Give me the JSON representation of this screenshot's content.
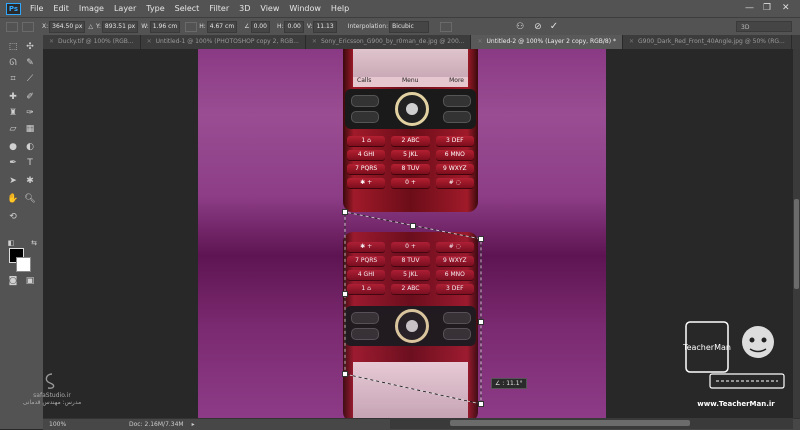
{
  "app": {
    "logo_text": "Ps"
  },
  "menu": [
    "File",
    "Edit",
    "Image",
    "Layer",
    "Type",
    "Select",
    "Filter",
    "3D",
    "View",
    "Window",
    "Help"
  ],
  "window_controls": [
    "—",
    "❐",
    "✕"
  ],
  "options_bar": {
    "x_label": "X:",
    "x_value": "364.50 px",
    "y_label": "Y:",
    "y_value": "893.51 px",
    "w_label": "W:",
    "w_value": "1.96 cm",
    "h_label": "H:",
    "h_value": "4.67 cm",
    "angle_value": "0.00",
    "hskew_label": "H:",
    "hskew_value": "0.00",
    "vskew_label": "V:",
    "vskew_value": "11.13",
    "interp_label": "Interpolation:",
    "interp_value": "Bicubic",
    "workspace": "3D"
  },
  "tabs": [
    {
      "label": "Ducky.tif @ 100% (RGB..."
    },
    {
      "label": "Untitled-1 @ 100% (PHOTOSHOP copy 2, RGB..."
    },
    {
      "label": "Sony_Ericsson_G900_by_r0man_de.jpg @ 200..."
    },
    {
      "label": "Untitled-2 @ 100% (Layer 2 copy, RGB/8) *"
    },
    {
      "label": "G900_Dark_Red_Front_40Angle.jpg @ 50% (RG..."
    }
  ],
  "phone": {
    "soft_keys": [
      "Calls",
      "Menu",
      "More"
    ],
    "keys": [
      "1 ⌂",
      "2 ABC",
      "3 DEF",
      "4 GHI",
      "5 JKL",
      "6 MNO",
      "7 PQRS",
      "8 TUV",
      "9 WXYZ",
      "✱ +",
      "0 +",
      "# ◌"
    ],
    "keys_reflect": [
      "✱ +",
      "0 +",
      "# ◌",
      "7 PQRS",
      "8 TUV",
      "9 WXYZ",
      "4 GHI",
      "5 JKL",
      "6 MNO",
      "1 ⌂",
      "2 ABC",
      "3 DEF"
    ]
  },
  "transform_readout": "∠ : 11.1°",
  "status": {
    "zoom": "100%",
    "doc": "Doc: 2.16M/7.34M"
  },
  "watermark_left": {
    "line1": "safaStudio.ir",
    "line2": "مدرس: مهندس قدمانی"
  },
  "watermark_right": {
    "brand": "TeacherMan",
    "site": "www.TeacherMan.ir"
  },
  "colors": {
    "accent": "#31a8ff",
    "chrome": "#535353",
    "canvas_bg": "#282828"
  }
}
